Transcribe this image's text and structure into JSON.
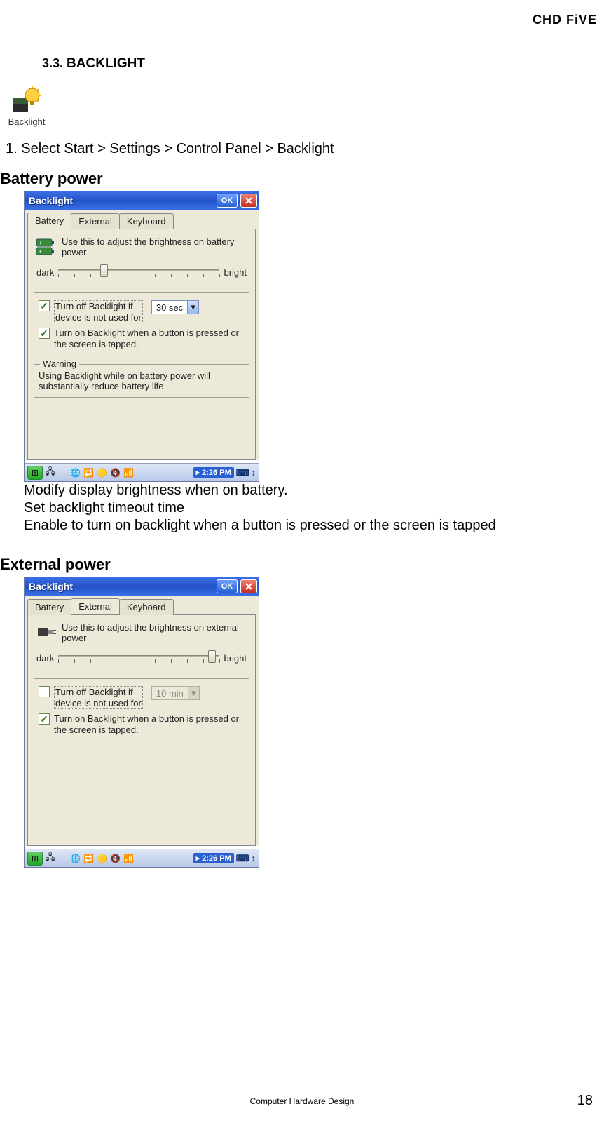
{
  "brand": "CHD FiVE",
  "section": {
    "number": "3.3.",
    "title_prefix": "B",
    "title_rest": "ACKLIGHT"
  },
  "icon_caption": "Backlight",
  "step1": "1.  Select Start > Settings > Control Panel > Backlight",
  "battery": {
    "heading": "Battery power",
    "window_title": "Backlight",
    "ok": "OK",
    "tabs": {
      "battery": "Battery",
      "external": "External",
      "keyboard": "Keyboard"
    },
    "hint": "Use this to adjust the brightness on battery power",
    "slider": {
      "left": "dark",
      "right": "bright",
      "pos": 0.28,
      "ticks": 11
    },
    "chk1_label_a": "Turn off Backlight if",
    "chk1_label_b": "device is not used for",
    "chk1_checked": true,
    "timeout_value": "30 sec",
    "chk2_label": "Turn on Backlight when a button is pressed or the screen is tapped.",
    "chk2_checked": true,
    "warning_legend": "Warning",
    "warning_text": "Using Backlight while on battery power will substantially reduce battery life.",
    "time": "2:26 PM",
    "notes": [
      "Modify display brightness when on battery.",
      "Set backlight timeout time",
      "Enable to turn on backlight when a button is pressed or the screen is tapped"
    ]
  },
  "external": {
    "heading": "External power",
    "window_title": "Backlight",
    "ok": "OK",
    "tabs": {
      "battery": "Battery",
      "external": "External",
      "keyboard": "Keyboard"
    },
    "hint": "Use this to adjust the brightness on external power",
    "slider": {
      "left": "dark",
      "right": "bright",
      "pos": 0.95,
      "ticks": 11
    },
    "chk1_label_a": "Turn off Backlight if",
    "chk1_label_b": "device is not used for",
    "chk1_checked": false,
    "timeout_value": "10 min",
    "chk2_label": "Turn on Backlight when a button is pressed or the screen is tapped.",
    "chk2_checked": true,
    "time": "2:26 PM"
  },
  "footer": "Computer Hardware Design",
  "page_number": "18"
}
